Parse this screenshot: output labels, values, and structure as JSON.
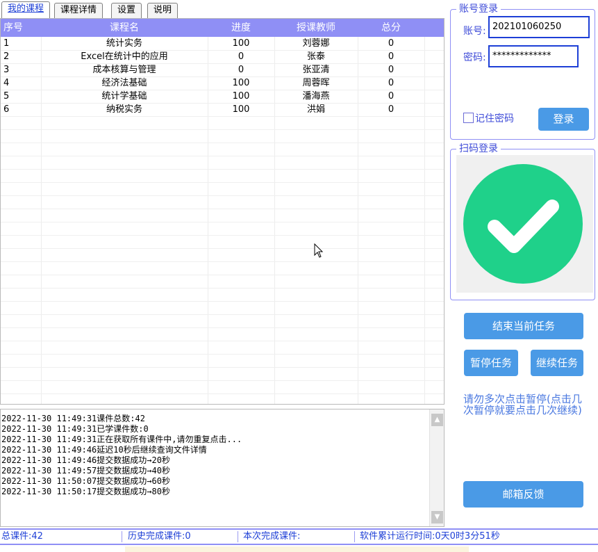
{
  "tabs": [
    "我的课程",
    "课程详情",
    "设置",
    "说明"
  ],
  "table": {
    "columns": [
      "序号",
      "课程名",
      "进度",
      "授课教师",
      "总分"
    ],
    "rows": [
      [
        "1",
        "统计实务",
        "100",
        "刘蓉娜",
        "0"
      ],
      [
        "2",
        "Excel在统计中的应用",
        "0",
        "张泰",
        "0"
      ],
      [
        "3",
        "成本核算与管理",
        "0",
        "张亚清",
        "0"
      ],
      [
        "4",
        "经济法基础",
        "100",
        "周蓉晖",
        "0"
      ],
      [
        "5",
        "统计学基础",
        "100",
        "潘海燕",
        "0"
      ],
      [
        "6",
        "纳税实务",
        "100",
        "洪娟",
        "0"
      ]
    ]
  },
  "log": {
    "lines": [
      "2022-11-30 11:49:31课件总数:42",
      "2022-11-30 11:49:31已学课件数:0",
      "2022-11-30 11:49:31正在获取所有课件中,请勿重复点击...",
      "2022-11-30 11:49:46延迟10秒后继续查询文件详情",
      "2022-11-30 11:49:46提交数据成功→20秒",
      "2022-11-30 11:49:57提交数据成功→40秒",
      "2022-11-30 11:50:07提交数据成功→60秒",
      "2022-11-30 11:50:17提交数据成功→80秒"
    ]
  },
  "status": {
    "total": "总课件:42",
    "history": "历史完成课件:0",
    "current": "本次完成课件:",
    "runtime": "软件累计运行时间:0天0时3分51秒"
  },
  "account": {
    "group_title": "账号登录",
    "username_label": "账号:",
    "username_value": "202101060250",
    "password_label": "密码:",
    "password_value": "*************",
    "remember_label": "记住密码",
    "login_button": "登录"
  },
  "qr_login": {
    "group_title": "扫码登录",
    "status_icon": "check-circle-icon",
    "icon_color": "#1fd18a"
  },
  "actions": {
    "end_task": "结束当前任务",
    "pause_task": "暂停任务",
    "resume_task": "继续任务",
    "feedback": "邮箱反馈"
  },
  "warning": "请勿多次点击暂停(点击几次暂停就要点击几次继续)",
  "colors": {
    "header_bg": "#8f8ff5",
    "button_bg": "#4a9ae6",
    "label_blue": "#3e4bd8"
  }
}
